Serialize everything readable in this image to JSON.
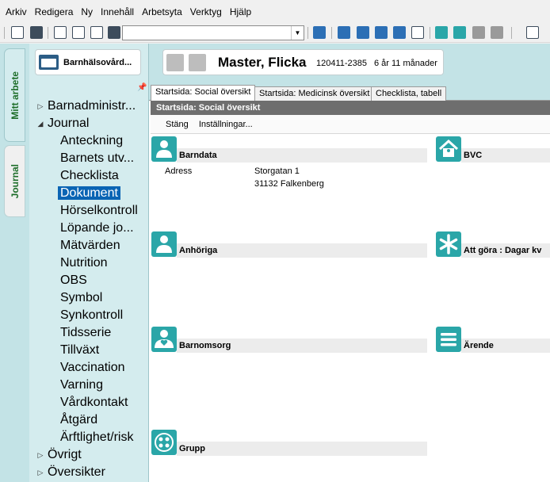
{
  "menubar": {
    "items": [
      "Arkiv",
      "Redigera",
      "Ny",
      "Innehåll",
      "Arbetsyta",
      "Verktyg",
      "Hjälp"
    ]
  },
  "toolbar": {
    "combo_value": "",
    "icons": [
      "search-icon",
      "close-icon",
      "print-icon",
      "copy-icon",
      "document-icon",
      "user-icon",
      "refresh-icon",
      "expand-icon",
      "grid-icon",
      "columns-icon",
      "rows-icon",
      "window-icon",
      "mail-icon",
      "star-icon",
      "puzzle-icon",
      "image-icon",
      "panel-icon"
    ]
  },
  "vertical_tabs": {
    "mitt_arbete": "Mitt arbete",
    "journal": "Journal"
  },
  "unit": {
    "name": "Barnhälsovård..."
  },
  "tree": {
    "barnadmin": "Barnadministr...",
    "journal": "Journal",
    "items": [
      "Anteckning",
      "Barnets utv...",
      "Checklista",
      "Dokument",
      "Hörselkontroll",
      "Löpande jo...",
      "Mätvärden",
      "Nutrition",
      "OBS",
      "Symbol",
      "Synkontroll",
      "Tidsserie",
      "Tillväxt",
      "Vaccination",
      "Varning",
      "Vårdkontakt",
      "Åtgärd",
      "Ärftlighet/risk"
    ],
    "selected": "Dokument",
    "ovrigt": "Övrigt",
    "oversikter": "Översikter"
  },
  "patient": {
    "name": "Master, Flicka",
    "id": "120411-2385",
    "age": "6 år 11 månader"
  },
  "tabs": [
    "Startsida: Social översikt",
    "Startsida: Medicinsk översikt",
    "Checklista, tabell"
  ],
  "page_title": "Startsida: Social översikt",
  "actions": [
    "Stäng",
    "Inställningar..."
  ],
  "sections": {
    "barndata": {
      "title": "Barndata",
      "address_label": "Adress",
      "address_line1": "Storgatan 1",
      "address_line2": "31132 Falkenberg"
    },
    "bvc": {
      "title": "BVC"
    },
    "anhoriga": {
      "title": "Anhöriga"
    },
    "attgora": {
      "title": "Att göra : Dagar kv"
    },
    "barnomsorg": {
      "title": "Barnomsorg"
    },
    "arende": {
      "title": "Ärende"
    },
    "grupp": {
      "title": "Grupp"
    }
  },
  "colors": {
    "accent": "#2aa6a8",
    "panel": "#c3e3e6",
    "nav": "#d4ecee",
    "selection": "#0a64b4",
    "title_bar": "#6e6e6e"
  }
}
